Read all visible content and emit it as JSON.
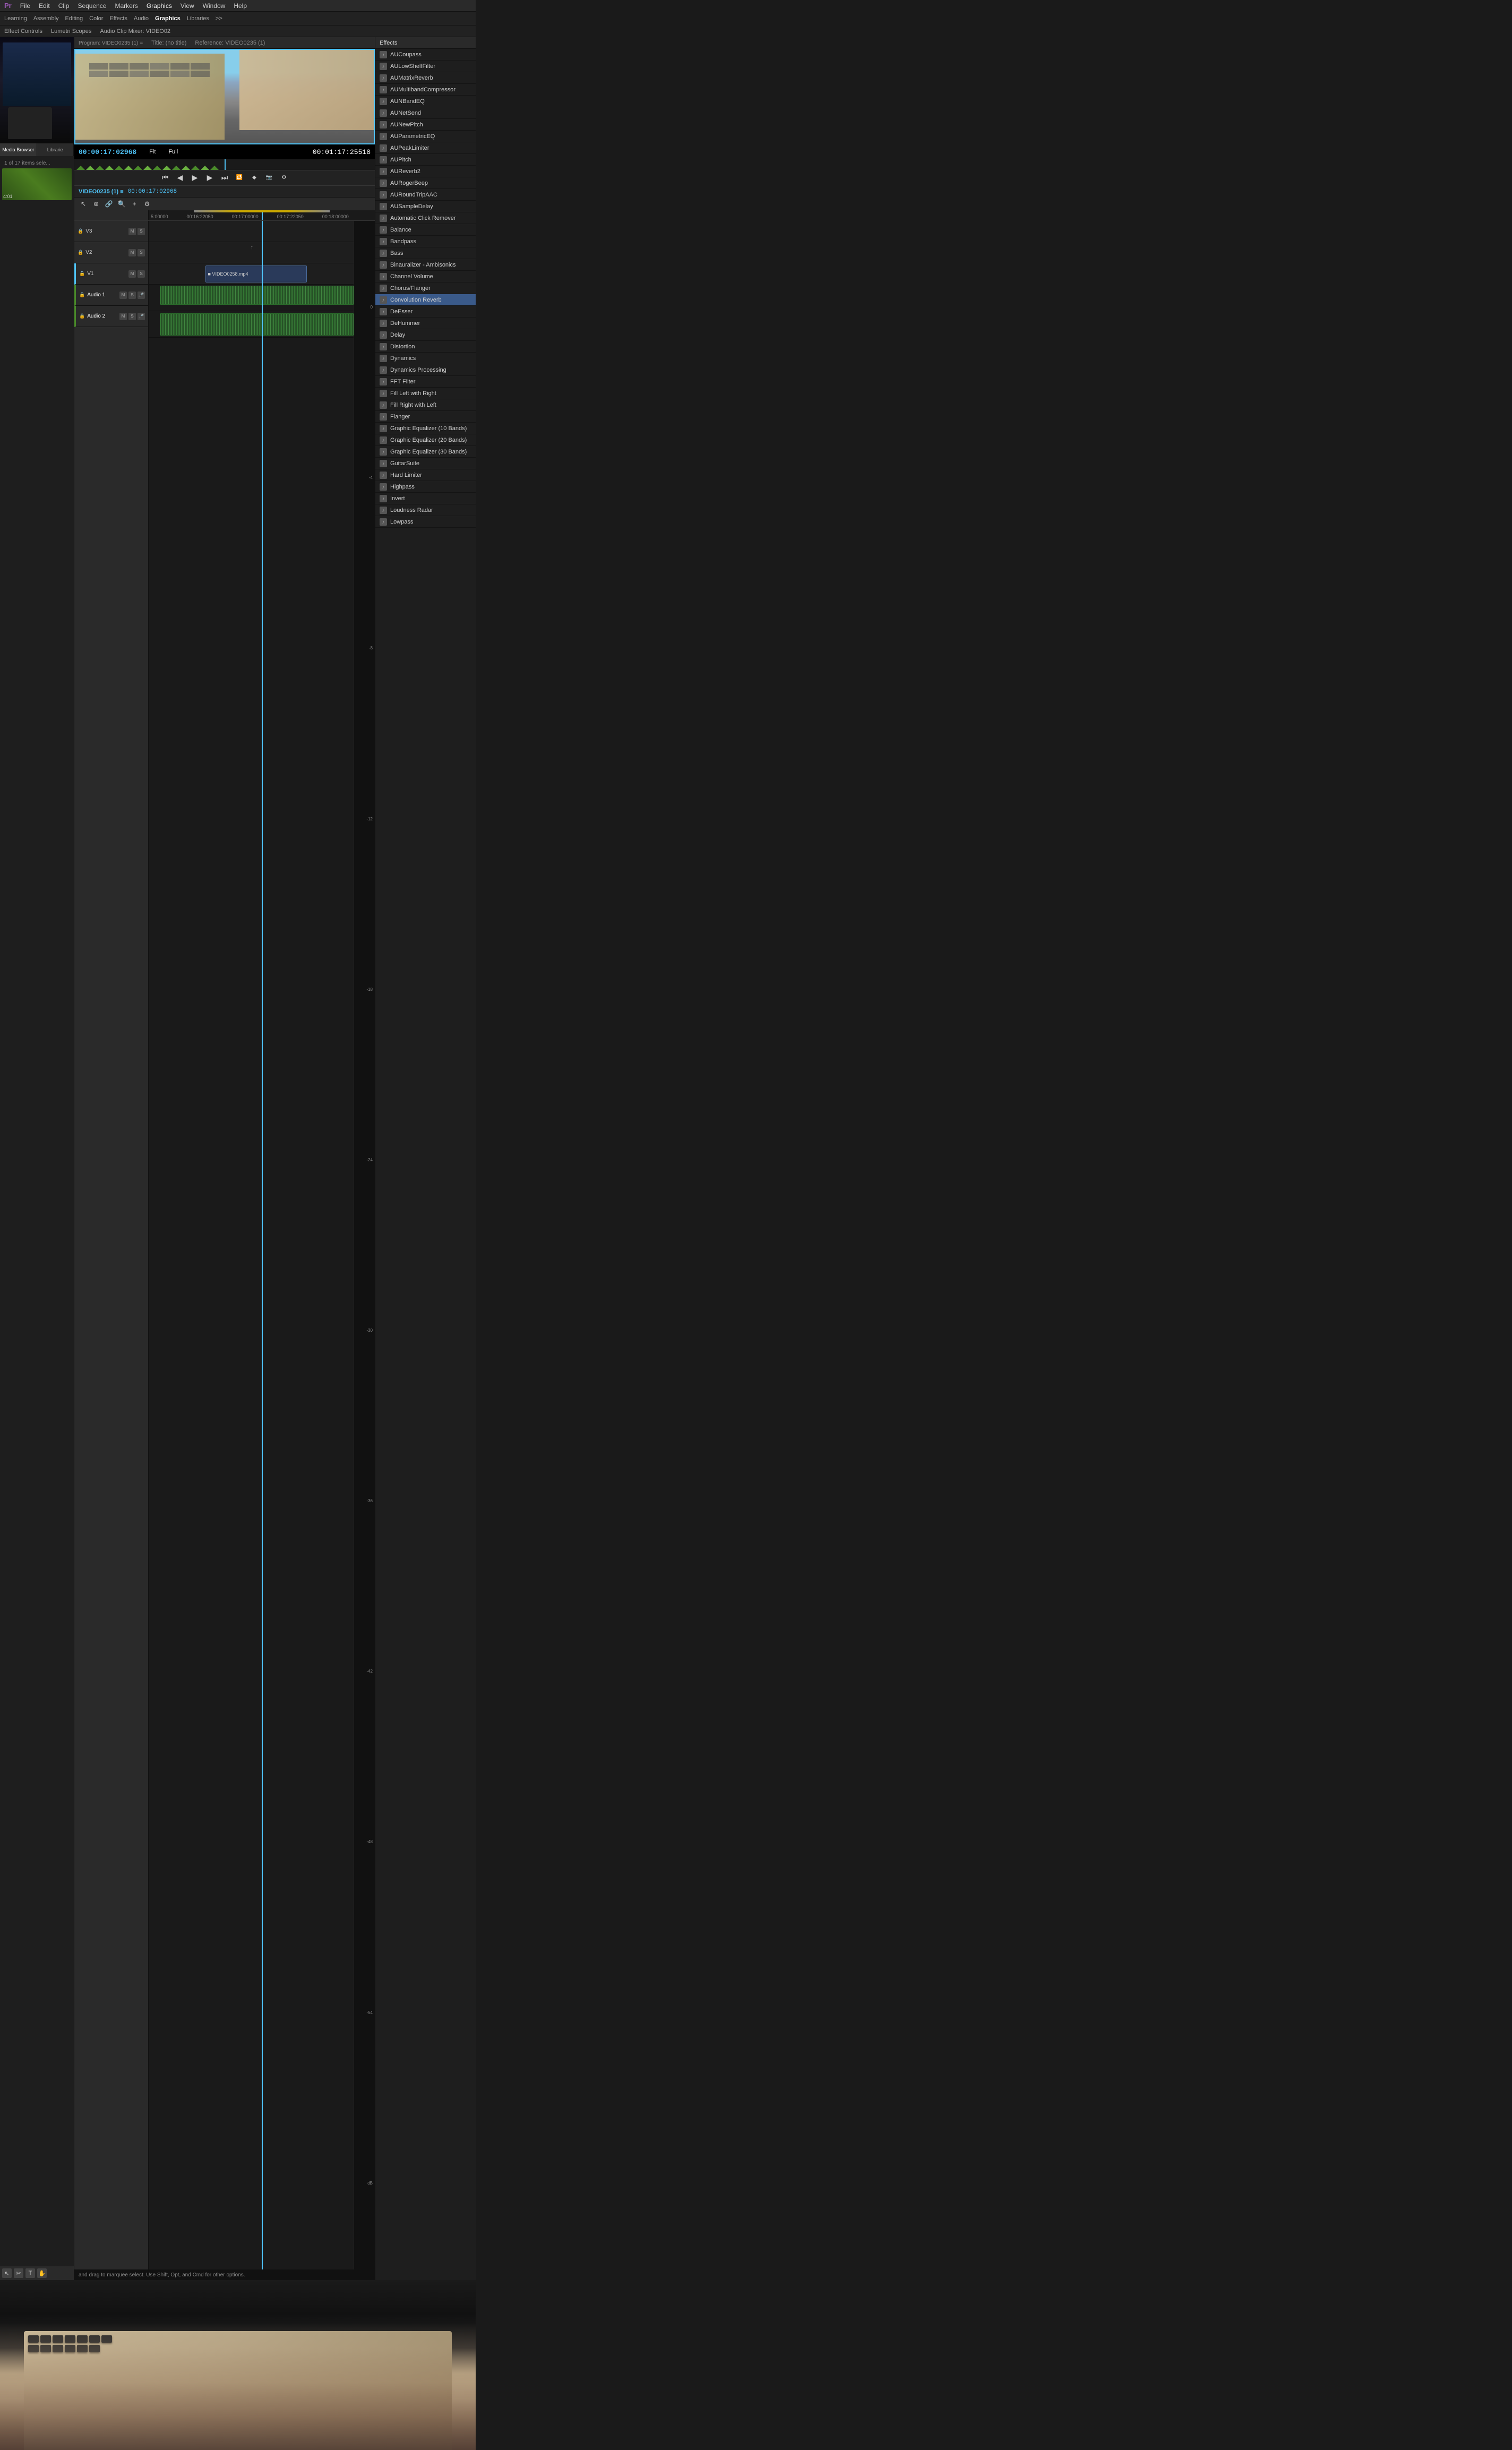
{
  "app": {
    "title": "Adobe Premiere Pro",
    "menu_items": [
      "File",
      "Edit",
      "Clip",
      "Sequence",
      "Markers",
      "Graphics",
      "View",
      "Window",
      "Help"
    ],
    "workspaces": [
      "Learning",
      "Assembly",
      "Editing",
      "Color",
      "Effects",
      "Audio",
      "Graphics",
      "Libraries",
      ">>"
    ]
  },
  "toolbar": {
    "panels": [
      "Effect Controls",
      "Lumetri Scopes",
      "Audio Clip Mixer: VIDEO02"
    ]
  },
  "program_monitor": {
    "title": "Program: VIDEO0235 (1)",
    "title_marker": "=",
    "no_title": "Title: (no title)",
    "reference": "Reference: VIDEO0235 (1)",
    "timecode_in": "00:00:17:02968",
    "timecode_out": "00:01:17:25518",
    "fit_label": "Fit",
    "full_label": "Full"
  },
  "timeline": {
    "sequence_name": "VIDEO0235 (1) ≡",
    "timecode": "00:00:17:02968",
    "ruler_marks": [
      "5:00000",
      "00:16:22050",
      "00:17:00000",
      "00:17:22050",
      "00:18:00000"
    ],
    "tracks": [
      {
        "id": "V3",
        "name": "V3",
        "type": "video"
      },
      {
        "id": "V2",
        "name": "V2",
        "type": "video"
      },
      {
        "id": "V1",
        "name": "V1",
        "type": "video"
      },
      {
        "id": "A1",
        "name": "Audio 1",
        "type": "audio"
      },
      {
        "id": "A2",
        "name": "Audio 2",
        "type": "audio"
      }
    ],
    "clips": [
      {
        "id": "video_clip_1",
        "label": "■ VIDEO0258.mp4",
        "track": "V1"
      },
      {
        "id": "audio_clip_1",
        "label": "",
        "track": "A1"
      },
      {
        "id": "audio_clip_2",
        "label": "",
        "track": "A2"
      }
    ],
    "db_marks": [
      "0",
      "-4",
      "-8",
      "-12",
      "-18",
      "-24",
      "-30",
      "-36",
      "-42",
      "-48",
      "-54",
      "dB"
    ]
  },
  "effects_panel": {
    "title": "Effects",
    "items": [
      {
        "id": "aucoupass",
        "name": "AUCoupass",
        "selected": false
      },
      {
        "id": "aulowshelffilter",
        "name": "AULowShelfFilter",
        "selected": false
      },
      {
        "id": "aumatrixreverb",
        "name": "AUMatrixReverb",
        "selected": false
      },
      {
        "id": "aumulitibandcompressor",
        "name": "AUMultibandCompressor",
        "selected": false
      },
      {
        "id": "aunbandeq",
        "name": "AUNBandEQ",
        "selected": false
      },
      {
        "id": "aunetsend",
        "name": "AUNetSend",
        "selected": false
      },
      {
        "id": "aunewpitch",
        "name": "AUNewPitch",
        "selected": false
      },
      {
        "id": "auparametriceq",
        "name": "AUParametricEQ",
        "selected": false
      },
      {
        "id": "aupeaklimiter",
        "name": "AUPeakLimiter",
        "selected": false
      },
      {
        "id": "aupitch",
        "name": "AUPitch",
        "selected": false
      },
      {
        "id": "aureverb2",
        "name": "AUReverb2",
        "selected": false
      },
      {
        "id": "aurogerbeep",
        "name": "AURogerBeep",
        "selected": false
      },
      {
        "id": "auroundtripaac",
        "name": "AURoundTripAAC",
        "selected": false
      },
      {
        "id": "ausampledelay",
        "name": "AUSampleDelay",
        "selected": false
      },
      {
        "id": "automaticclickremover",
        "name": "Automatic Click Remover",
        "selected": false
      },
      {
        "id": "balance",
        "name": "Balance",
        "selected": false
      },
      {
        "id": "bandpass",
        "name": "Bandpass",
        "selected": false
      },
      {
        "id": "bass",
        "name": "Bass",
        "selected": false
      },
      {
        "id": "binauraizer",
        "name": "Binauralizer - Ambisonics",
        "selected": false
      },
      {
        "id": "channelvolume",
        "name": "Channel Volume",
        "selected": false
      },
      {
        "id": "chorusflanger",
        "name": "Chorus/Flanger",
        "selected": false
      },
      {
        "id": "convolutionreverb",
        "name": "Convolution Reverb",
        "selected": true
      },
      {
        "id": "desser",
        "name": "DeEsser",
        "selected": false
      },
      {
        "id": "dehummer",
        "name": "DeHummer",
        "selected": false
      },
      {
        "id": "delay",
        "name": "Delay",
        "selected": false
      },
      {
        "id": "distortion",
        "name": "Distortion",
        "selected": false
      },
      {
        "id": "dynamics",
        "name": "Dynamics",
        "selected": false
      },
      {
        "id": "dynamicsprocessing",
        "name": "Dynamics Processing",
        "selected": false
      },
      {
        "id": "fftfilter",
        "name": "FFT Filter",
        "selected": false
      },
      {
        "id": "fillleftwithright",
        "name": "Fill Left with Right",
        "selected": false
      },
      {
        "id": "fillrightwithleft",
        "name": "Fill Right with Left",
        "selected": false
      },
      {
        "id": "flanger",
        "name": "Flanger",
        "selected": false
      },
      {
        "id": "graphiceq10",
        "name": "Graphic Equalizer (10 Bands)",
        "selected": false
      },
      {
        "id": "graphiceq20",
        "name": "Graphic Equalizer (20 Bands)",
        "selected": false
      },
      {
        "id": "graphiceq30",
        "name": "Graphic Equalizer (30 Bands)",
        "selected": false
      },
      {
        "id": "guitarsuite",
        "name": "GuitarSuite",
        "selected": false
      },
      {
        "id": "hardlimiter",
        "name": "Hard Limiter",
        "selected": false
      },
      {
        "id": "highpass",
        "name": "Highpass",
        "selected": false
      },
      {
        "id": "invert",
        "name": "Invert",
        "selected": false
      },
      {
        "id": "loudnessradar",
        "name": "Loudness Radar",
        "selected": false
      },
      {
        "id": "lowpass",
        "name": "Lowpass",
        "selected": false
      }
    ]
  },
  "media_browser": {
    "tab": "Media Browser",
    "library_tab": "Librarie",
    "item_count": "1 of 17 items sele...",
    "timecode": "4:01"
  },
  "status_bar": {
    "text": "and drag to marquee select. Use Shift, Opt, and Cmd for other options."
  },
  "colors": {
    "accent_blue": "#4fc3f7",
    "timeline_green": "#4a8a2a",
    "selected_bg": "#3a5a8a",
    "track_v": "#2a3a5a",
    "track_a": "#1a3a1a"
  }
}
